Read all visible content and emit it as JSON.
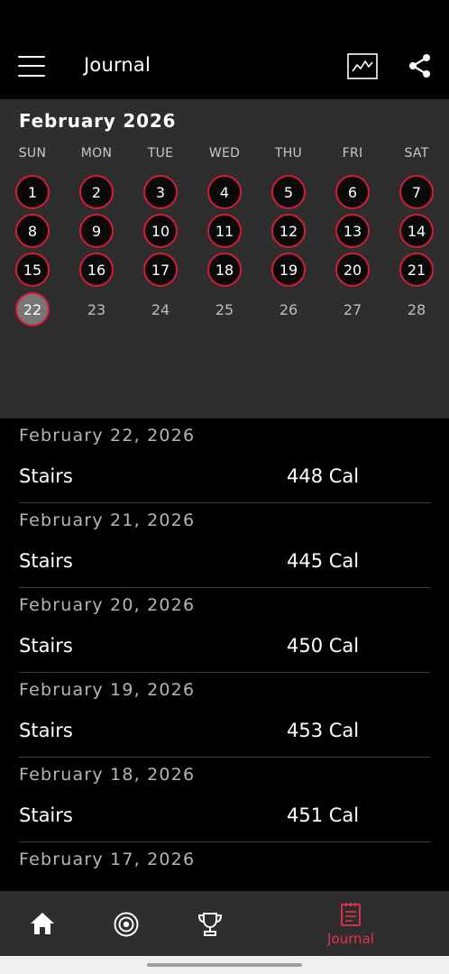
{
  "header": {
    "title": "Journal"
  },
  "calendar": {
    "month_label": "February 2026",
    "weekdays": [
      "SUN",
      "MON",
      "TUE",
      "WED",
      "THU",
      "FRI",
      "SAT"
    ],
    "days": [
      {
        "label": "1",
        "state": "workout"
      },
      {
        "label": "2",
        "state": "workout"
      },
      {
        "label": "3",
        "state": "workout"
      },
      {
        "label": "4",
        "state": "workout"
      },
      {
        "label": "5",
        "state": "workout"
      },
      {
        "label": "6",
        "state": "workout"
      },
      {
        "label": "7",
        "state": "workout"
      },
      {
        "label": "8",
        "state": "workout"
      },
      {
        "label": "9",
        "state": "workout"
      },
      {
        "label": "10",
        "state": "workout"
      },
      {
        "label": "11",
        "state": "workout"
      },
      {
        "label": "12",
        "state": "workout"
      },
      {
        "label": "13",
        "state": "workout"
      },
      {
        "label": "14",
        "state": "workout"
      },
      {
        "label": "15",
        "state": "workout"
      },
      {
        "label": "16",
        "state": "workout"
      },
      {
        "label": "17",
        "state": "workout"
      },
      {
        "label": "18",
        "state": "workout"
      },
      {
        "label": "19",
        "state": "workout"
      },
      {
        "label": "20",
        "state": "workout"
      },
      {
        "label": "21",
        "state": "workout"
      },
      {
        "label": "22",
        "state": "today"
      },
      {
        "label": "23",
        "state": "future"
      },
      {
        "label": "24",
        "state": "future"
      },
      {
        "label": "25",
        "state": "future"
      },
      {
        "label": "26",
        "state": "future"
      },
      {
        "label": "27",
        "state": "future"
      },
      {
        "label": "28",
        "state": "future"
      }
    ]
  },
  "entries": [
    {
      "date": "February 22, 2026",
      "activity": "Stairs",
      "calories": "448 Cal"
    },
    {
      "date": "February 21, 2026",
      "activity": "Stairs",
      "calories": "445 Cal"
    },
    {
      "date": "February 20, 2026",
      "activity": "Stairs",
      "calories": "450 Cal"
    },
    {
      "date": "February 19, 2026",
      "activity": "Stairs",
      "calories": "453 Cal"
    },
    {
      "date": "February 18, 2026",
      "activity": "Stairs",
      "calories": "451 Cal"
    },
    {
      "date": "February 17, 2026",
      "activity": "",
      "calories": ""
    }
  ],
  "bottom_nav": {
    "items": [
      {
        "icon": "home-icon",
        "label": ""
      },
      {
        "icon": "target-icon",
        "label": ""
      },
      {
        "icon": "trophy-icon",
        "label": ""
      },
      {
        "icon": "journal-icon",
        "label": "Journal"
      }
    ]
  },
  "colors": {
    "accent": "#d91a36",
    "nav_active": "#e8314f",
    "calendar_bg": "#2e2e2e",
    "background": "#000000"
  }
}
